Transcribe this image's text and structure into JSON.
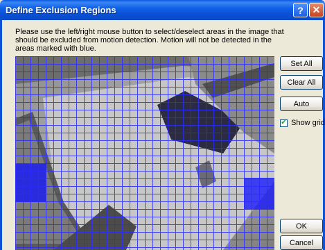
{
  "window": {
    "title": "Define Exclusion Regions",
    "help_glyph": "?",
    "close_glyph": "✕"
  },
  "instructions": "Please use the left/right mouse button to select/deselect areas in the image that should be excluded from motion detection. Motion will not be detected in the areas marked with blue.",
  "buttons": {
    "set_all": "Set All",
    "clear_all": "Clear All",
    "auto": "Auto",
    "ok": "OK",
    "cancel": "Cancel"
  },
  "show_grid": {
    "label": "Show grid",
    "checked": true,
    "check_glyph": "✔"
  },
  "colors": {
    "titlebar": "#0b52d6",
    "grid_line": "#2a2aff",
    "excluded_region": "#1010ff",
    "dialog_bg": "#ece9d8"
  },
  "icons": {
    "help": "help-icon",
    "close": "close-icon",
    "check": "checkmark-icon"
  }
}
